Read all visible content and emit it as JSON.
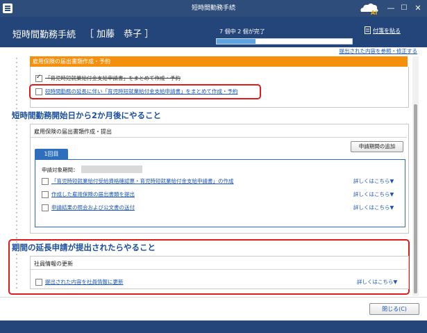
{
  "window": {
    "title": "短時間勤務手続",
    "logo_text": "AI",
    "controls": {
      "minimize": "—",
      "maximize": "☐",
      "close": "✕"
    }
  },
  "header": {
    "app_title": "短時間勤務手続",
    "user": "［ 加藤　恭子 ］",
    "progress_text": "7 個中 2 個が完了",
    "progress_fraction": 0.2857,
    "memo_link": "付箋を貼る",
    "ref_link": "提出された内容を参照・修正する"
  },
  "section1": {
    "title": "雇用保険の届出書類作成・予約",
    "tasks": [
      {
        "label": "「育児時短就業給付金支給申請書」をまとめて作成・予約",
        "checked": true,
        "done": true
      },
      {
        "label": "短時間勤務の延長に伴い「育児時短就業給付金支給申請書」をまとめて作成・予約",
        "checked": false,
        "done": false
      }
    ]
  },
  "section2": {
    "heading": "短時間勤務開始日から2か月後にやること",
    "panel_title": "雇用保険の届出書類作成・提出",
    "period_button": "申請期間の追加",
    "tab_label": "1回目",
    "period_label": "申請対象期間：",
    "tasks": [
      {
        "label": "「育児時短就業給付受給資格確認票・育児時短就業給付金支給申請書」の作成",
        "detail": "詳しくはこちら▼"
      },
      {
        "label": "作成した雇用保険の届出書類を提出",
        "detail": "詳しくはこちら▼"
      },
      {
        "label": "申請結果の照会および公文書の送付",
        "detail": "詳しくはこちら▼"
      }
    ]
  },
  "section3": {
    "heading": "期間の延長申請が提出されたらやること",
    "panel_title": "社員情報の更新",
    "tasks": [
      {
        "label": "提出された内容を社員情報に更新",
        "detail": "詳しくはこちら▼"
      }
    ]
  },
  "footer": {
    "close_button": "閉じる(C)"
  },
  "colors": {
    "header": "#24457a",
    "accent": "#f5900c",
    "link": "#1a55b5",
    "highlight": "#e01a1a"
  }
}
